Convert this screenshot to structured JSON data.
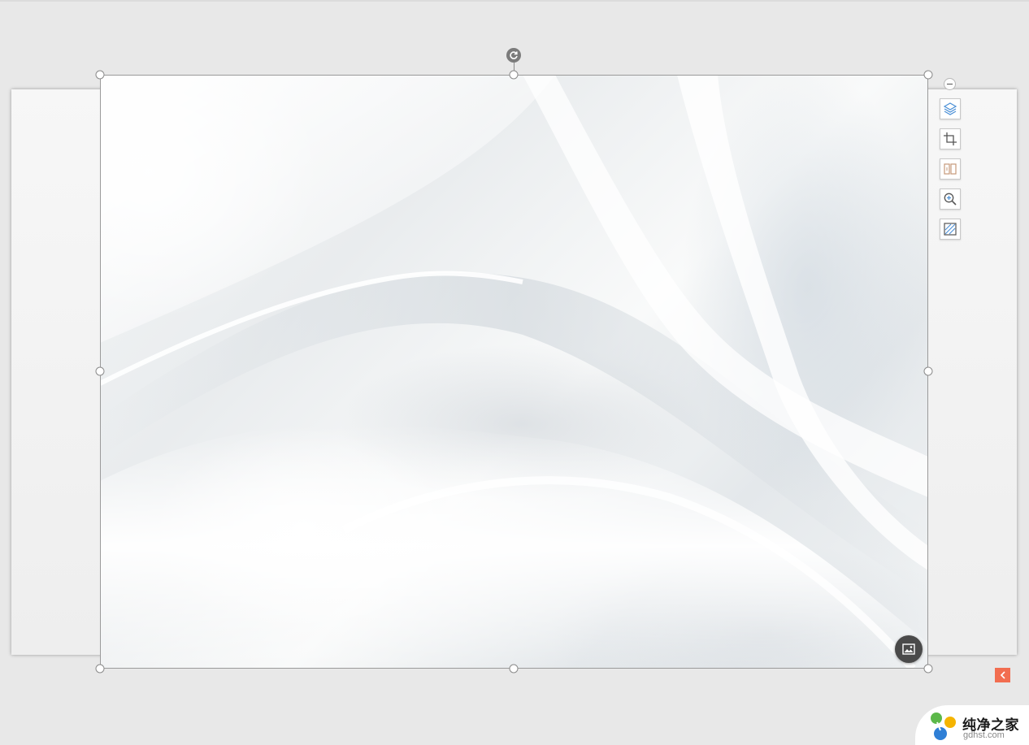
{
  "slide": {
    "picture": {
      "description_icon": "image-icon"
    }
  },
  "toolbar": {
    "items": [
      {
        "name": "layers-icon"
      },
      {
        "name": "crop-icon"
      },
      {
        "name": "picture-split-icon"
      },
      {
        "name": "zoom-in-icon"
      },
      {
        "name": "picture-border-icon"
      }
    ],
    "collapse_icon": "minus-icon"
  },
  "side_panel": {
    "expand_icon": "chevron-left-icon"
  },
  "watermark": {
    "name": "纯净之家",
    "url": "gdhst.com"
  },
  "colors": {
    "accent": "#f26d50",
    "handle_border": "#8a8a8a",
    "dark_button": "#4a4a4a"
  }
}
